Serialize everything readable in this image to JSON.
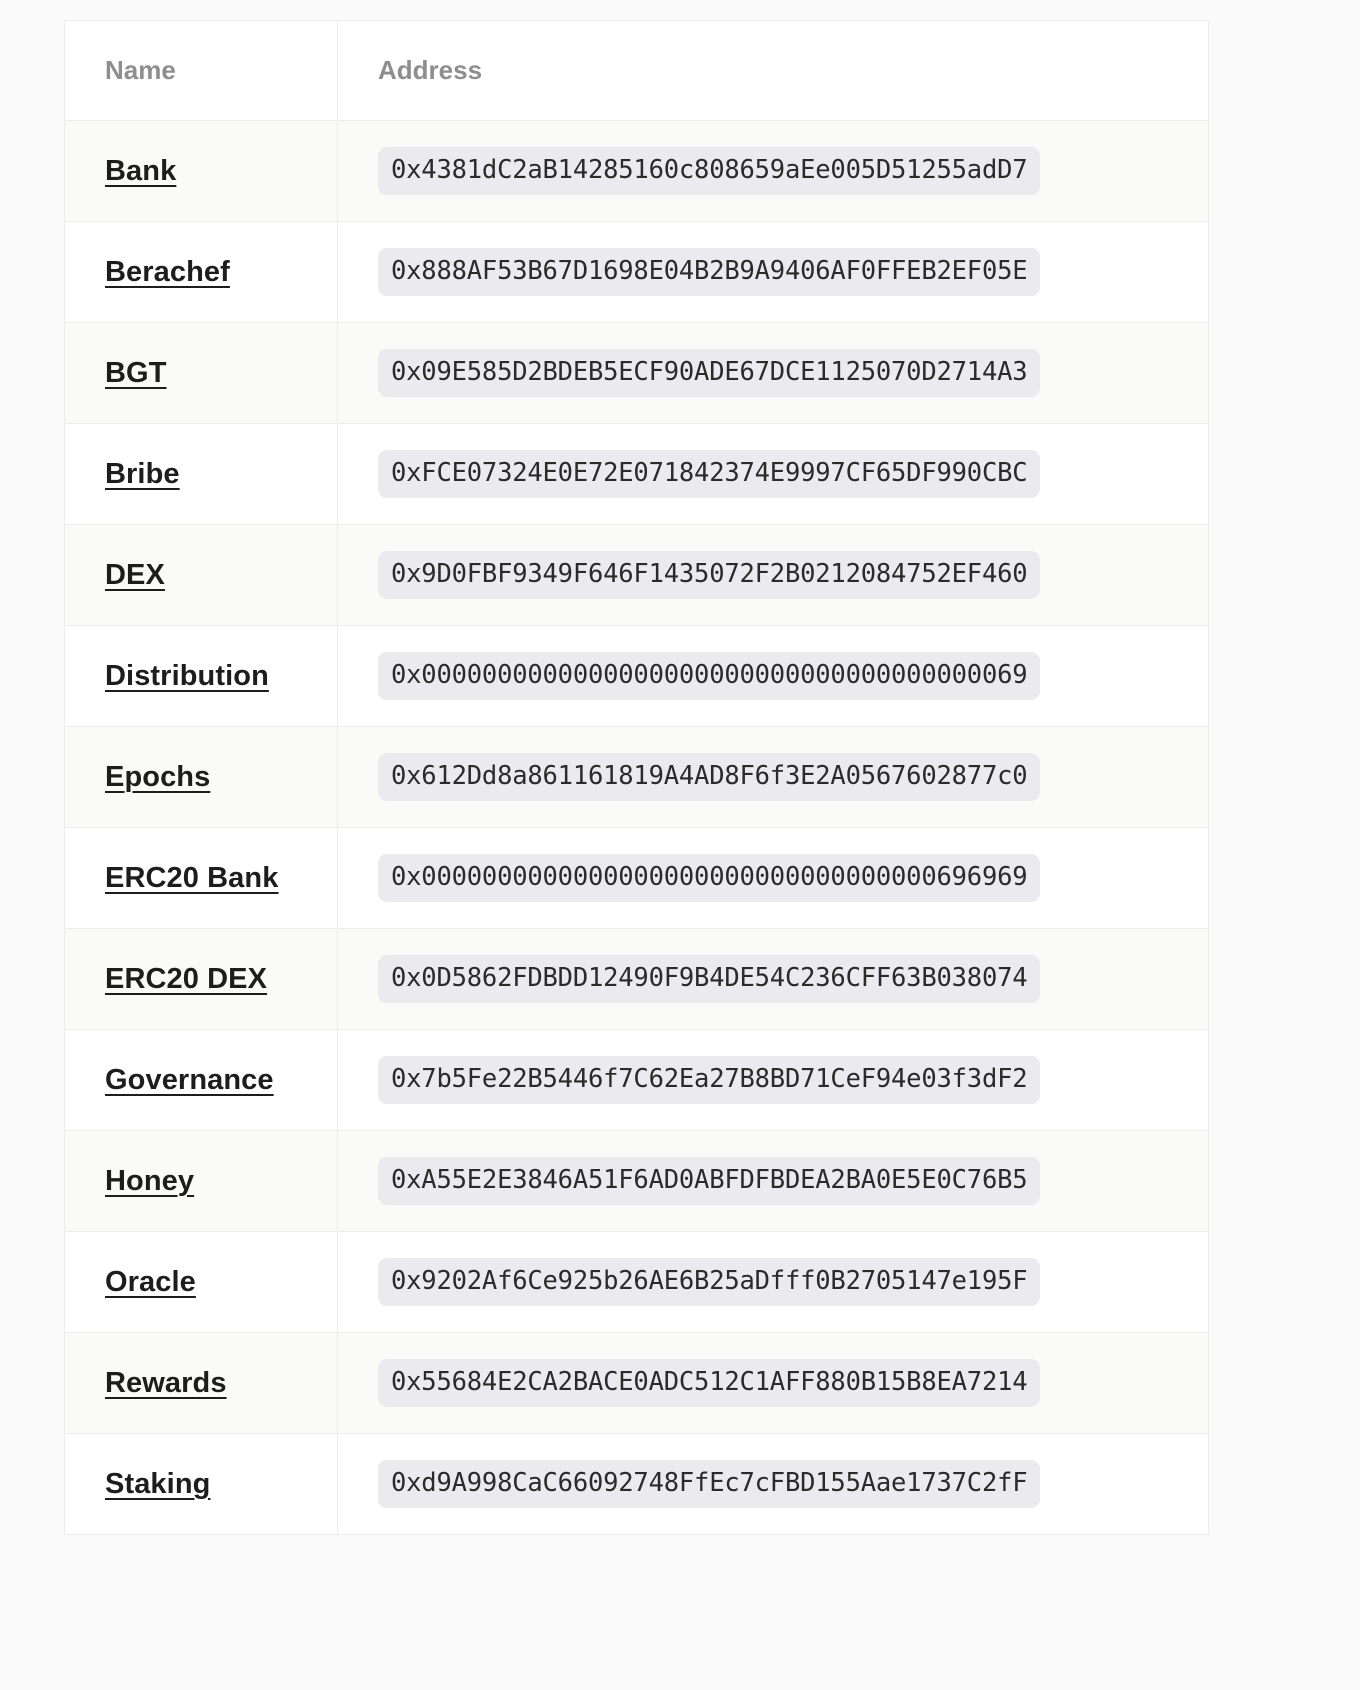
{
  "table": {
    "columns": [
      {
        "key": "name",
        "label": "Name"
      },
      {
        "key": "address",
        "label": "Address"
      }
    ],
    "rows": [
      {
        "name": "Bank",
        "address": "0x4381dC2aB14285160c808659aEe005D51255adD7"
      },
      {
        "name": "Berachef",
        "address": "0x888AF53B67D1698E04B2B9A9406AF0FFEB2EF05E"
      },
      {
        "name": "BGT",
        "address": "0x09E585D2BDEB5ECF90ADE67DCE1125070D2714A3"
      },
      {
        "name": "Bribe",
        "address": "0xFCE07324E0E72E071842374E9997CF65DF990CBC"
      },
      {
        "name": "DEX",
        "address": "0x9D0FBF9349F646F1435072F2B0212084752EF460"
      },
      {
        "name": "Distribution",
        "address": "0x0000000000000000000000000000000000000069"
      },
      {
        "name": "Epochs",
        "address": "0x612Dd8a861161819A4AD8F6f3E2A0567602877c0"
      },
      {
        "name": "ERC20 Bank",
        "address": "0x0000000000000000000000000000000000696969"
      },
      {
        "name": "ERC20 DEX",
        "address": "0x0D5862FDBDD12490F9B4DE54C236CFF63B038074"
      },
      {
        "name": "Governance",
        "address": "0x7b5Fe22B5446f7C62Ea27B8BD71CeF94e03f3dF2"
      },
      {
        "name": "Honey",
        "address": "0xA55E2E3846A51F6AD0ABFDFBDEA2BA0E5E0C76B5"
      },
      {
        "name": "Oracle",
        "address": "0x9202Af6Ce925b26AE6B25aDfff0B2705147e195F"
      },
      {
        "name": "Rewards",
        "address": "0x55684E2CA2BACE0ADC512C1AFF880B15B8EA7214"
      },
      {
        "name": "Staking",
        "address": "0xd9A998CaC66092748FfEc7cFBD155Aae1737C2fF"
      }
    ]
  },
  "colors": {
    "page_background": "#fafafa",
    "row_background": "#ffffff",
    "row_background_alt": "#fafaf9",
    "border": "#eceded",
    "header_text": "#8e8e8e",
    "name_text": "#1d1d1d",
    "address_pill_background": "#ebebef",
    "address_text": "#2b2b2b"
  }
}
